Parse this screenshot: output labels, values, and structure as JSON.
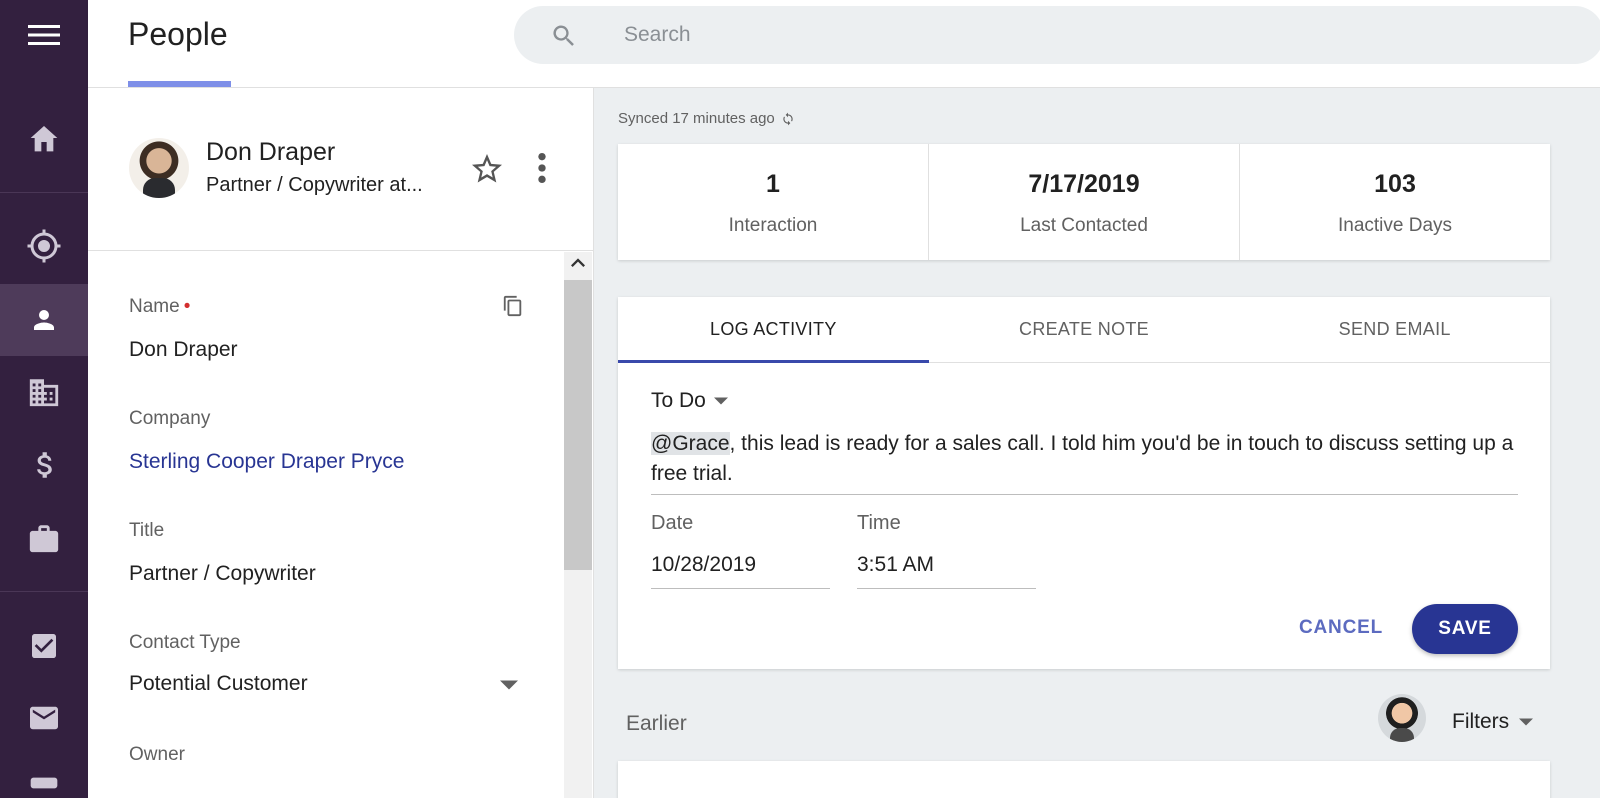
{
  "nav": {
    "items": [
      {
        "name": "home",
        "icon": "home-icon"
      },
      {
        "name": "leads",
        "icon": "target-icon"
      },
      {
        "name": "people",
        "icon": "person-icon",
        "active": true
      },
      {
        "name": "companies",
        "icon": "building-icon"
      },
      {
        "name": "opportunities",
        "icon": "dollar-icon"
      },
      {
        "name": "projects",
        "icon": "briefcase-icon"
      },
      {
        "name": "tasks",
        "icon": "checkbox-icon"
      },
      {
        "name": "email",
        "icon": "mail-icon"
      }
    ],
    "colors": {
      "rail": "#33203f",
      "active": "#4e3b5a"
    }
  },
  "header": {
    "title": "People",
    "search_placeholder": "Search"
  },
  "contact": {
    "name": "Don Draper",
    "subtitle": "Partner / Copywriter at..."
  },
  "fields": {
    "name_label": "Name",
    "name_required": "•",
    "name_value": "Don Draper",
    "company_label": "Company",
    "company_value": "Sterling Cooper Draper Pryce",
    "title_label": "Title",
    "title_value": "Partner / Copywriter",
    "contact_type_label": "Contact Type",
    "contact_type_value": "Potential Customer",
    "owner_label": "Owner"
  },
  "sync": {
    "text": "Synced 17 minutes ago"
  },
  "stats": [
    {
      "value": "1",
      "label": "Interaction"
    },
    {
      "value": "7/17/2019",
      "label": "Last Contacted"
    },
    {
      "value": "103",
      "label": "Inactive Days"
    }
  ],
  "activity": {
    "tabs": [
      {
        "label": "LOG ACTIVITY",
        "active": true
      },
      {
        "label": "CREATE NOTE",
        "active": false
      },
      {
        "label": "SEND EMAIL",
        "active": false
      }
    ],
    "type": "To Do",
    "mention": "@Grace",
    "note_rest": ", this lead is ready for a sales call. I told him you'd be in touch to discuss setting up a free trial.",
    "date_label": "Date",
    "date_value": "10/28/2019",
    "time_label": "Time",
    "time_value": "3:51 AM",
    "cancel_label": "CANCEL",
    "save_label": "SAVE",
    "accent": "#283593"
  },
  "feed": {
    "earlier_label": "Earlier",
    "filters_label": "Filters"
  }
}
